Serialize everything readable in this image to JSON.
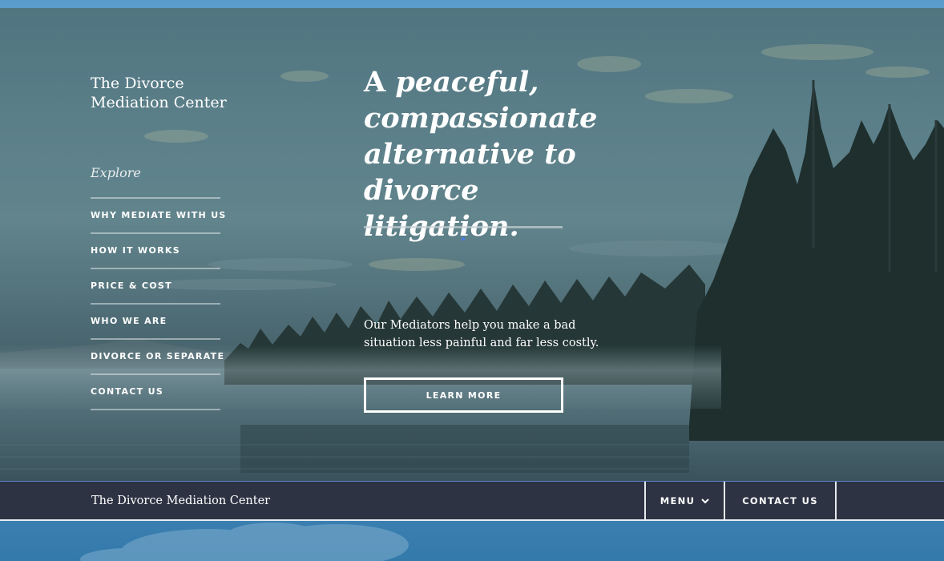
{
  "site": {
    "name_line1": "The Divorce",
    "name_line2": "Mediation Center"
  },
  "sidebar": {
    "explore_label": "Explore",
    "items": [
      {
        "label": "WHY MEDIATE WITH US"
      },
      {
        "label": "HOW IT WORKS"
      },
      {
        "label": "PRICE & COST"
      },
      {
        "label": "WHO WE ARE"
      },
      {
        "label": "DIVORCE OR SEPARATE"
      },
      {
        "label": "CONTACT US"
      }
    ]
  },
  "hero": {
    "headline_word1": "A",
    "headline_rest": " peaceful, compassionate alternative to divorce litigation.",
    "tagline": "Our Mediators help you make a bad situation less painful and far less costly.",
    "cta_label": "LEARN MORE"
  },
  "footer_bar": {
    "brand": "The Divorce Mediation Center",
    "menu_label": "MENU",
    "contact_label": "CONTACT US"
  },
  "icons": {
    "menu_chevron": "chevron-down-icon"
  },
  "colors": {
    "top_accent": "#5a9ccb",
    "footer_bg": "#2d3343",
    "button_border": "#ffffff"
  }
}
